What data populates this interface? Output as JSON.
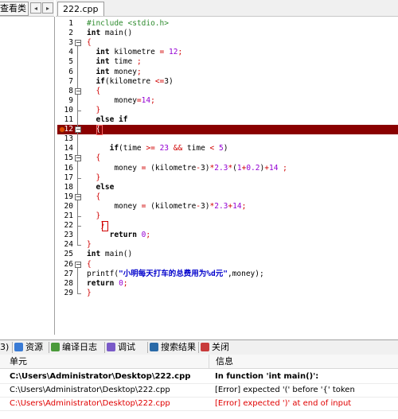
{
  "left_panel": {
    "tab_label": "查看类",
    "nav_prev": "◂",
    "nav_next": "▸"
  },
  "editor": {
    "file_tab": "222.cpp",
    "lines": [
      {
        "n": "1",
        "segments": [
          {
            "t": "#include <stdio.h>",
            "c": "pre"
          }
        ]
      },
      {
        "n": "2",
        "segments": [
          {
            "t": "int",
            "c": "kw"
          },
          {
            "t": " main()",
            "c": ""
          }
        ]
      },
      {
        "n": "3",
        "segments": [
          {
            "t": "{",
            "c": "op"
          }
        ]
      },
      {
        "n": "4",
        "segments": [
          {
            "t": "  int",
            "c": "kw"
          },
          {
            "t": " kilometre ",
            "c": ""
          },
          {
            "t": "=",
            "c": "op"
          },
          {
            "t": " ",
            "c": ""
          },
          {
            "t": "12",
            "c": "num"
          },
          {
            "t": ";",
            "c": "op"
          }
        ]
      },
      {
        "n": "5",
        "segments": [
          {
            "t": "  int",
            "c": "kw"
          },
          {
            "t": " time ",
            "c": ""
          },
          {
            "t": ";",
            "c": "op"
          }
        ]
      },
      {
        "n": "6",
        "segments": [
          {
            "t": "  int",
            "c": "kw"
          },
          {
            "t": " money",
            "c": ""
          },
          {
            "t": ";",
            "c": "op"
          }
        ]
      },
      {
        "n": "7",
        "segments": [
          {
            "t": "  if",
            "c": "kw"
          },
          {
            "t": "(kilometre ",
            "c": ""
          },
          {
            "t": "<=",
            "c": "op"
          },
          {
            "t": "3)",
            "c": ""
          }
        ]
      },
      {
        "n": "8",
        "segments": [
          {
            "t": "  {",
            "c": "op"
          }
        ]
      },
      {
        "n": "9",
        "segments": [
          {
            "t": "      money",
            "c": ""
          },
          {
            "t": "=",
            "c": "op"
          },
          {
            "t": "14",
            "c": "num"
          },
          {
            "t": ";",
            "c": "op"
          }
        ]
      },
      {
        "n": "10",
        "segments": [
          {
            "t": "  }",
            "c": "op"
          }
        ]
      },
      {
        "n": "11",
        "segments": [
          {
            "t": "  else if",
            "c": "kw"
          }
        ]
      },
      {
        "n": "12",
        "segments": [
          {
            "t": "  {",
            "c": "op"
          }
        ]
      },
      {
        "n": "13",
        "segments": [
          {
            "t": "",
            "c": ""
          }
        ]
      },
      {
        "n": "14",
        "segments": [
          {
            "t": "     if",
            "c": "kw"
          },
          {
            "t": "(time ",
            "c": ""
          },
          {
            "t": ">=",
            "c": "op"
          },
          {
            "t": " ",
            "c": ""
          },
          {
            "t": "23",
            "c": "num"
          },
          {
            "t": " ",
            "c": ""
          },
          {
            "t": "&&",
            "c": "op"
          },
          {
            "t": " time ",
            "c": ""
          },
          {
            "t": "<",
            "c": "op"
          },
          {
            "t": " ",
            "c": ""
          },
          {
            "t": "5",
            "c": "num"
          },
          {
            "t": ")",
            "c": ""
          }
        ]
      },
      {
        "n": "15",
        "segments": [
          {
            "t": "  {",
            "c": "op"
          }
        ]
      },
      {
        "n": "16",
        "segments": [
          {
            "t": "      money ",
            "c": ""
          },
          {
            "t": "=",
            "c": "op"
          },
          {
            "t": " (kilometre",
            "c": ""
          },
          {
            "t": "-",
            "c": "op"
          },
          {
            "t": "3)",
            "c": ""
          },
          {
            "t": "*",
            "c": "op"
          },
          {
            "t": "2.3",
            "c": "num"
          },
          {
            "t": "*",
            "c": "op"
          },
          {
            "t": "(",
            "c": ""
          },
          {
            "t": "1",
            "c": "num"
          },
          {
            "t": "+",
            "c": "op"
          },
          {
            "t": "0.2",
            "c": "num"
          },
          {
            "t": ")",
            "c": ""
          },
          {
            "t": "+",
            "c": "op"
          },
          {
            "t": "14",
            "c": "num"
          },
          {
            "t": " ;",
            "c": "op"
          }
        ]
      },
      {
        "n": "17",
        "segments": [
          {
            "t": "  }",
            "c": "op"
          }
        ]
      },
      {
        "n": "18",
        "segments": [
          {
            "t": "  else",
            "c": "kw"
          }
        ]
      },
      {
        "n": "19",
        "segments": [
          {
            "t": "  {",
            "c": "op"
          }
        ]
      },
      {
        "n": "20",
        "segments": [
          {
            "t": "      money ",
            "c": ""
          },
          {
            "t": "=",
            "c": "op"
          },
          {
            "t": " (kilometre",
            "c": ""
          },
          {
            "t": "-",
            "c": "op"
          },
          {
            "t": "3)",
            "c": ""
          },
          {
            "t": "*",
            "c": "op"
          },
          {
            "t": "2.3",
            "c": "num"
          },
          {
            "t": "+",
            "c": "op"
          },
          {
            "t": "14",
            "c": "num"
          },
          {
            "t": ";",
            "c": "op"
          }
        ]
      },
      {
        "n": "21",
        "segments": [
          {
            "t": "  }",
            "c": "op"
          }
        ]
      },
      {
        "n": "22",
        "segments": [
          {
            "t": "   }",
            "c": "op"
          }
        ]
      },
      {
        "n": "23",
        "segments": [
          {
            "t": "     return",
            "c": "kw"
          },
          {
            "t": " ",
            "c": ""
          },
          {
            "t": "0",
            "c": "num"
          },
          {
            "t": ";",
            "c": "op"
          }
        ]
      },
      {
        "n": "24",
        "segments": [
          {
            "t": "}",
            "c": "op"
          }
        ]
      },
      {
        "n": "25",
        "segments": [
          {
            "t": "int",
            "c": "kw"
          },
          {
            "t": " main()",
            "c": ""
          }
        ]
      },
      {
        "n": "26",
        "segments": [
          {
            "t": "{",
            "c": "op"
          }
        ]
      },
      {
        "n": "27",
        "segments": [
          {
            "t": "printf(",
            "c": ""
          },
          {
            "t": "\"小明每天打车的总费用为%d元\"",
            "c": "str"
          },
          {
            "t": ",money);",
            "c": ""
          }
        ]
      },
      {
        "n": "28",
        "segments": [
          {
            "t": "return",
            "c": "kw"
          },
          {
            "t": " ",
            "c": ""
          },
          {
            "t": "0",
            "c": "num"
          },
          {
            "t": ";",
            "c": "op"
          }
        ]
      },
      {
        "n": "29",
        "segments": [
          {
            "t": "}",
            "c": "op"
          }
        ]
      }
    ],
    "highlight_line": "12",
    "breakpoint_line": "12"
  },
  "bottom_tabs": [
    {
      "label": "3)",
      "icon": "partial-tab"
    },
    {
      "label": "资源",
      "icon": "resources-icon"
    },
    {
      "label": "编译日志",
      "icon": "compile-log-icon"
    },
    {
      "label": "调试",
      "icon": "debug-icon"
    },
    {
      "label": "搜索结果",
      "icon": "search-results-icon"
    },
    {
      "label": "关闭",
      "icon": "close-icon"
    }
  ],
  "messages": {
    "headers": {
      "unit": "单元",
      "info": "信息"
    },
    "rows": [
      {
        "unit": "C:\\Users\\Administrator\\Desktop\\222.cpp",
        "info": "In function 'int main()':",
        "bold": true,
        "error": false
      },
      {
        "unit": "C:\\Users\\Administrator\\Desktop\\222.cpp",
        "info": "[Error] expected '(' before '{' token",
        "bold": false,
        "error": false
      },
      {
        "unit": "C:\\Users\\Administrator\\Desktop\\222.cpp",
        "info": "[Error] expected ')' at end of input",
        "bold": false,
        "error": true
      }
    ]
  },
  "colors": {
    "highlight": "#8a0000",
    "error_text": "#e00000",
    "keyword": "#000000",
    "preprocessor": "#2e8b2e",
    "number": "#9400d3",
    "operator": "#d00000",
    "string": "#0000cc"
  }
}
